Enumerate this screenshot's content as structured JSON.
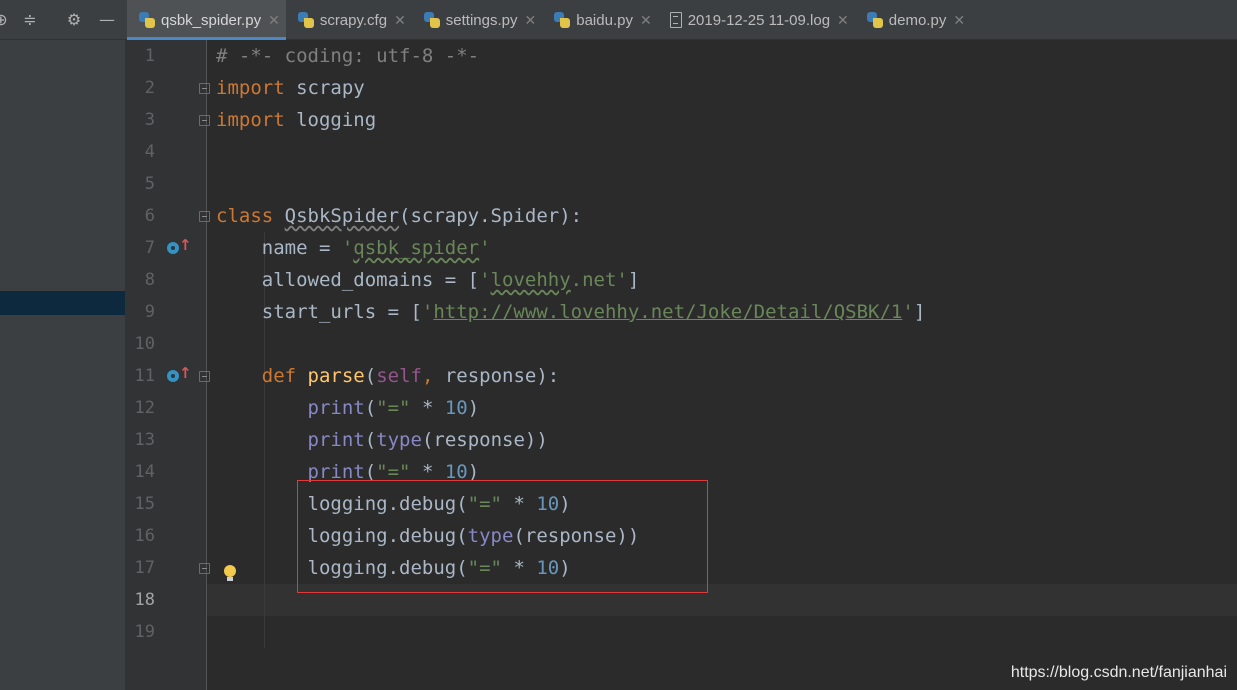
{
  "toolbar": {
    "icons": [
      "target-icon",
      "collapse-icon",
      "gear-icon",
      "minimize-icon"
    ]
  },
  "tabs": [
    {
      "label": "qsbk_spider.py",
      "icon": "python-file-icon",
      "active": true
    },
    {
      "label": "scrapy.cfg",
      "icon": "python-file-icon",
      "active": false
    },
    {
      "label": "settings.py",
      "icon": "python-file-icon",
      "active": false
    },
    {
      "label": "baidu.py",
      "icon": "python-file-icon",
      "active": false
    },
    {
      "label": "2019-12-25 11-09.log",
      "icon": "log-file-icon",
      "active": false
    },
    {
      "label": "demo.py",
      "icon": "python-file-icon",
      "active": false
    }
  ],
  "editor": {
    "current_line": 18,
    "line_numbers": [
      "1",
      "2",
      "3",
      "4",
      "5",
      "6",
      "7",
      "8",
      "9",
      "10",
      "11",
      "12",
      "13",
      "14",
      "15",
      "16",
      "17",
      "18",
      "19"
    ],
    "lines": [
      [
        {
          "t": "# -*- coding: utf-8 -*-",
          "c": "com"
        }
      ],
      [
        {
          "t": "import",
          "c": "kw"
        },
        {
          "t": " scrapy"
        }
      ],
      [
        {
          "t": "import",
          "c": "kw"
        },
        {
          "t": " logging"
        }
      ],
      [],
      [],
      [
        {
          "t": "class",
          "c": "kw"
        },
        {
          "t": " "
        },
        {
          "t": "QsbkSpider",
          "c": "wvplain"
        },
        {
          "t": "(scrapy.Spider):"
        }
      ],
      [
        {
          "t": "    name = "
        },
        {
          "t": "'",
          "c": "str"
        },
        {
          "t": "qsbk_spider",
          "c": "str wv"
        },
        {
          "t": "'",
          "c": "str"
        }
      ],
      [
        {
          "t": "    allowed_domains = ["
        },
        {
          "t": "'",
          "c": "str"
        },
        {
          "t": "lovehhy",
          "c": "str wv"
        },
        {
          "t": ".net'",
          "c": "str"
        },
        {
          "t": "]"
        }
      ],
      [
        {
          "t": "    start_urls = ["
        },
        {
          "t": "'",
          "c": "str"
        },
        {
          "t": "http://www.lovehhy.net/Joke/Detail/QSBK/1",
          "c": "str ul"
        },
        {
          "t": "'",
          "c": "str"
        },
        {
          "t": "]"
        }
      ],
      [],
      [
        {
          "t": "    "
        },
        {
          "t": "def",
          "c": "kw"
        },
        {
          "t": " "
        },
        {
          "t": "parse",
          "c": "fn"
        },
        {
          "t": "("
        },
        {
          "t": "self",
          "c": "self"
        },
        {
          "t": ",",
          "c": "kw"
        },
        {
          "t": " response):"
        }
      ],
      [
        {
          "t": "        "
        },
        {
          "t": "print",
          "c": "bi"
        },
        {
          "t": "("
        },
        {
          "t": "\"=\"",
          "c": "str"
        },
        {
          "t": " * "
        },
        {
          "t": "10",
          "c": "num"
        },
        {
          "t": ")"
        }
      ],
      [
        {
          "t": "        "
        },
        {
          "t": "print",
          "c": "bi"
        },
        {
          "t": "("
        },
        {
          "t": "type",
          "c": "bi"
        },
        {
          "t": "(response))"
        }
      ],
      [
        {
          "t": "        "
        },
        {
          "t": "print",
          "c": "bi"
        },
        {
          "t": "("
        },
        {
          "t": "\"=\"",
          "c": "str"
        },
        {
          "t": " * "
        },
        {
          "t": "10",
          "c": "num"
        },
        {
          "t": ")"
        }
      ],
      [
        {
          "t": "        logging.debug("
        },
        {
          "t": "\"=\"",
          "c": "str"
        },
        {
          "t": " * "
        },
        {
          "t": "10",
          "c": "num"
        },
        {
          "t": ")"
        }
      ],
      [
        {
          "t": "        logging.debug("
        },
        {
          "t": "type",
          "c": "bi"
        },
        {
          "t": "(response))"
        }
      ],
      [
        {
          "t": "        logging.debug("
        },
        {
          "t": "\"=\"",
          "c": "str"
        },
        {
          "t": " * "
        },
        {
          "t": "10",
          "c": "num"
        },
        {
          "t": ")"
        }
      ],
      [],
      []
    ]
  },
  "watermark": "https://blog.csdn.net/fanjianhai"
}
